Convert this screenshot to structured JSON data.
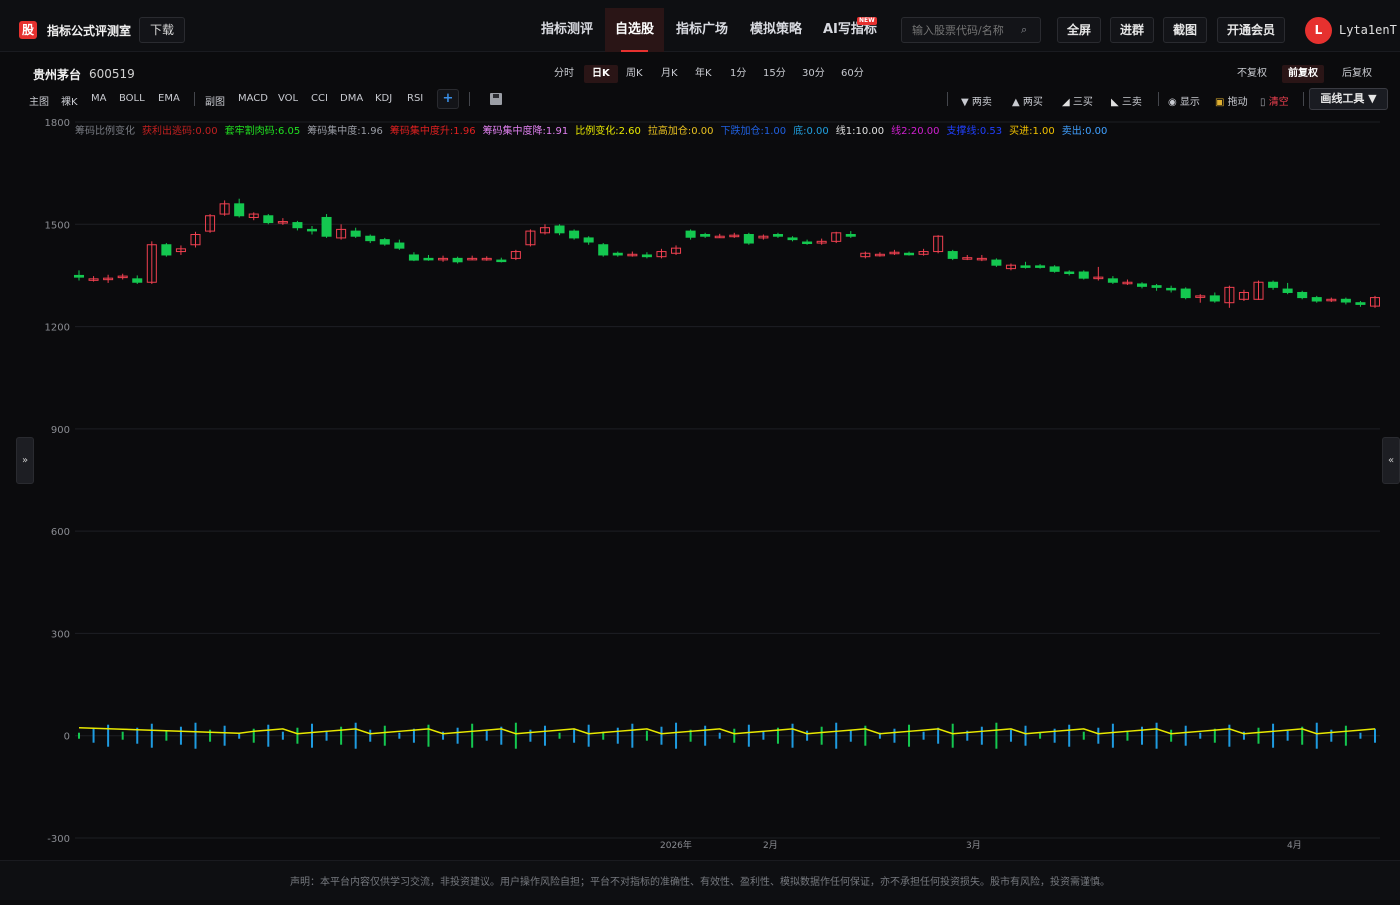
{
  "brand": {
    "logo_char": "股",
    "name": "指标公式评测室",
    "download": "下载"
  },
  "nav": [
    "指标测评",
    "自选股",
    "指标广场",
    "模拟策略",
    "AI写指标"
  ],
  "nav_new_tag": "NEW",
  "search": {
    "placeholder": "输入股票代码/名称"
  },
  "top_buttons": [
    "全屏",
    "进群",
    "截图",
    "开通会员"
  ],
  "user": {
    "avatar": "L",
    "name": "Lyta1enT"
  },
  "stock": {
    "name": "贵州茅台",
    "code": "600519"
  },
  "period_tabs": [
    "分时",
    "日K",
    "周K",
    "月K",
    "年K",
    "1分",
    "15分",
    "30分",
    "60分"
  ],
  "right_tabs": [
    "不复权",
    "前复权",
    "后复权"
  ],
  "indicator_tabs": [
    "主图",
    "裸K",
    "MA",
    "BOLL",
    "EMA",
    "副图",
    "MACD",
    "VOL",
    "CCI",
    "DMA",
    "KDJ",
    "RSI"
  ],
  "plus_label": "+",
  "draw_tools": [
    "▼ 两卖",
    "▲ 两买",
    "三买",
    "三卖",
    "显示",
    "拖动",
    "清空"
  ],
  "draw_button": "画线工具 ▼",
  "side_toggle_left": "»",
  "side_toggle_right": "«",
  "footer": "声明：本平台内容仅供学习交流，非投资建议。用户操作风险自担；平台不对指标的准确性、有效性、盈利性、模拟数据作任何保证，亦不承担任何投资损失。股市有风险，投资需谨慎。",
  "colors": {
    "up": "#f04050",
    "down": "#14c850",
    "accent": "#e6312f",
    "bg": "#0b0b0d"
  },
  "chart_data": {
    "type": "candlestick",
    "ylim": [
      -300,
      1800
    ],
    "yticks": [
      1800,
      1500,
      1200,
      900,
      600,
      300,
      0,
      -300
    ],
    "xticks": [
      "2026年",
      "2月",
      "3月",
      "4月"
    ],
    "legend": [
      {
        "label": "筹码比例变化",
        "color": "#7a7d85"
      },
      {
        "label": "获利出逃码:0.00",
        "color": "#c02020"
      },
      {
        "label": "套牢割肉码:6.05",
        "color": "#20e020"
      },
      {
        "label": "筹码集中度:1.96",
        "color": "#9a9da5"
      },
      {
        "label": "筹码集中度升:1.96",
        "color": "#e02020"
      },
      {
        "label": "筹码集中度降:1.91",
        "color": "#e080f0"
      },
      {
        "label": "比例变化:2.60",
        "color": "#e8e800"
      },
      {
        "label": "拉高加仓:0.00",
        "color": "#e8c020"
      },
      {
        "label": "下跌加仓:1.00",
        "color": "#2060e0"
      },
      {
        "label": "底:0.00",
        "color": "#20a0e0"
      },
      {
        "label": "线1:10.00",
        "color": "#e0e0e0"
      },
      {
        "label": "线2:20.00",
        "color": "#d020d0"
      },
      {
        "label": "支撑线:0.53",
        "color": "#2040ff"
      },
      {
        "label": "买进:1.00",
        "color": "#f0c000"
      },
      {
        "label": "卖出:0.00",
        "color": "#40a0ff"
      }
    ],
    "candles": [
      [
        1350,
        1345,
        1365,
        1335
      ],
      [
        1340,
        1340,
        1348,
        1332
      ],
      [
        1340,
        1342,
        1352,
        1328
      ],
      [
        1345,
        1348,
        1355,
        1338
      ],
      [
        1340,
        1330,
        1350,
        1325
      ],
      [
        1330,
        1440,
        1450,
        1325
      ],
      [
        1440,
        1410,
        1445,
        1405
      ],
      [
        1420,
        1428,
        1438,
        1410
      ],
      [
        1440,
        1470,
        1478,
        1432
      ],
      [
        1480,
        1525,
        1530,
        1475
      ],
      [
        1530,
        1560,
        1570,
        1525
      ],
      [
        1560,
        1525,
        1575,
        1520
      ],
      [
        1520,
        1530,
        1535,
        1512
      ],
      [
        1525,
        1505,
        1530,
        1500
      ],
      [
        1505,
        1508,
        1518,
        1498
      ],
      [
        1505,
        1490,
        1510,
        1482
      ],
      [
        1485,
        1484,
        1495,
        1470
      ],
      [
        1520,
        1465,
        1530,
        1460
      ],
      [
        1460,
        1485,
        1500,
        1455
      ],
      [
        1480,
        1465,
        1490,
        1460
      ],
      [
        1465,
        1452,
        1470,
        1445
      ],
      [
        1455,
        1442,
        1460,
        1437
      ],
      [
        1445,
        1430,
        1455,
        1425
      ],
      [
        1410,
        1395,
        1418,
        1392
      ],
      [
        1400,
        1398,
        1410,
        1393
      ],
      [
        1400,
        1400,
        1408,
        1390
      ],
      [
        1400,
        1390,
        1405,
        1385
      ],
      [
        1400,
        1400,
        1408,
        1395
      ],
      [
        1400,
        1400,
        1406,
        1393
      ],
      [
        1395,
        1393,
        1402,
        1388
      ],
      [
        1400,
        1420,
        1425,
        1395
      ],
      [
        1440,
        1480,
        1485,
        1435
      ],
      [
        1475,
        1490,
        1500,
        1470
      ],
      [
        1495,
        1475,
        1500,
        1468
      ],
      [
        1480,
        1460,
        1485,
        1455
      ],
      [
        1460,
        1448,
        1465,
        1440
      ],
      [
        1440,
        1410,
        1445,
        1405
      ],
      [
        1415,
        1410,
        1420,
        1405
      ],
      [
        1410,
        1412,
        1420,
        1405
      ],
      [
        1410,
        1405,
        1418,
        1400
      ],
      [
        1405,
        1420,
        1428,
        1400
      ],
      [
        1415,
        1430,
        1438,
        1410
      ],
      [
        1480,
        1462,
        1485,
        1455
      ],
      [
        1470,
        1465,
        1475,
        1460
      ],
      [
        1465,
        1465,
        1472,
        1460
      ],
      [
        1465,
        1468,
        1475,
        1460
      ],
      [
        1470,
        1445,
        1475,
        1440
      ],
      [
        1460,
        1465,
        1470,
        1455
      ],
      [
        1470,
        1465,
        1475,
        1460
      ],
      [
        1460,
        1455,
        1465,
        1450
      ],
      [
        1448,
        1445,
        1455,
        1440
      ],
      [
        1445,
        1450,
        1458,
        1440
      ],
      [
        1450,
        1475,
        1478,
        1445
      ],
      [
        1470,
        1465,
        1480,
        1460
      ],
      [
        1405,
        1415,
        1420,
        1400
      ],
      [
        1410,
        1412,
        1418,
        1405
      ],
      [
        1415,
        1418,
        1425,
        1410
      ],
      [
        1415,
        1412,
        1420,
        1408
      ],
      [
        1412,
        1420,
        1428,
        1408
      ],
      [
        1420,
        1465,
        1468,
        1415
      ],
      [
        1420,
        1400,
        1425,
        1395
      ],
      [
        1400,
        1402,
        1410,
        1395
      ],
      [
        1400,
        1400,
        1410,
        1392
      ],
      [
        1395,
        1380,
        1400,
        1375
      ],
      [
        1370,
        1380,
        1385,
        1365
      ],
      [
        1378,
        1375,
        1390,
        1370
      ],
      [
        1378,
        1375,
        1383,
        1370
      ],
      [
        1375,
        1362,
        1380,
        1358
      ],
      [
        1360,
        1358,
        1365,
        1350
      ],
      [
        1360,
        1342,
        1365,
        1338
      ],
      [
        1345,
        1345,
        1375,
        1335
      ],
      [
        1340,
        1330,
        1348,
        1325
      ],
      [
        1330,
        1330,
        1338,
        1322
      ],
      [
        1325,
        1318,
        1330,
        1312
      ],
      [
        1320,
        1315,
        1325,
        1305
      ],
      [
        1312,
        1310,
        1320,
        1300
      ],
      [
        1310,
        1285,
        1315,
        1280
      ],
      [
        1290,
        1290,
        1295,
        1270
      ],
      [
        1290,
        1275,
        1300,
        1270
      ],
      [
        1270,
        1315,
        1320,
        1255
      ],
      [
        1280,
        1300,
        1308,
        1275
      ],
      [
        1280,
        1330,
        1335,
        1278
      ],
      [
        1330,
        1315,
        1335,
        1308
      ],
      [
        1310,
        1300,
        1328,
        1295
      ],
      [
        1300,
        1285,
        1305,
        1280
      ],
      [
        1285,
        1275,
        1290,
        1270
      ],
      [
        1278,
        1280,
        1285,
        1272
      ],
      [
        1280,
        1272,
        1285,
        1265
      ],
      [
        1270,
        1265,
        1275,
        1258
      ],
      [
        1260,
        1285,
        1290,
        1255
      ]
    ]
  }
}
